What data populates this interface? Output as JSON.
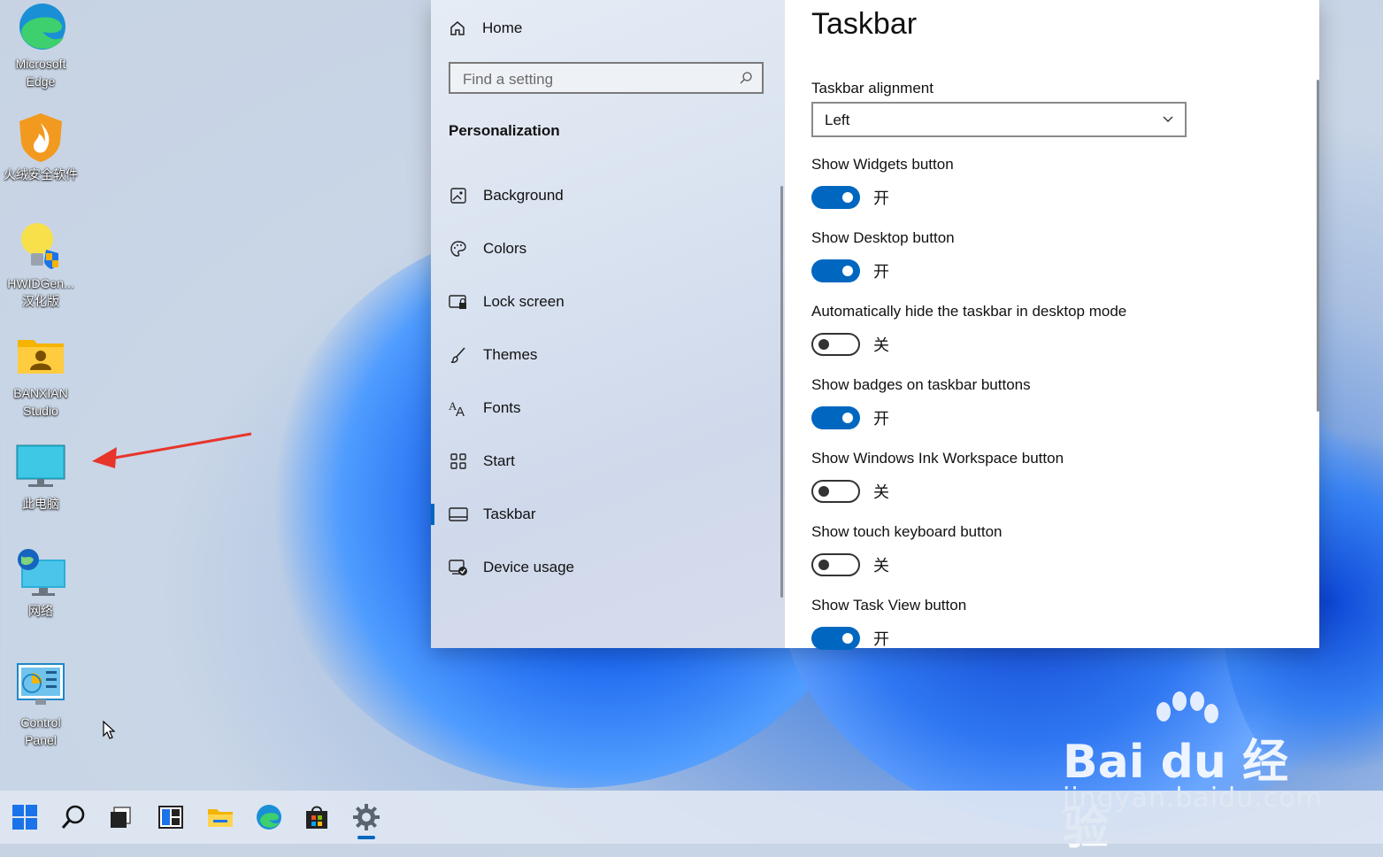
{
  "desktop": {
    "icons": [
      {
        "label": "Microsoft\nEdge",
        "icon": "edge-icon"
      },
      {
        "label": "火绒安全软件",
        "icon": "huorong-security-icon"
      },
      {
        "label": "HWIDGen...\n汉化版",
        "icon": "lightbulb-app-icon"
      },
      {
        "label": "BANXIAN\nStudio",
        "icon": "user-folder-icon"
      },
      {
        "label": "此电脑",
        "icon": "this-pc-icon"
      },
      {
        "label": "网络",
        "icon": "network-icon"
      },
      {
        "label": "Control\nPanel",
        "icon": "control-panel-icon"
      }
    ]
  },
  "settings": {
    "home_label": "Home",
    "search_placeholder": "Find a setting",
    "section_title": "Personalization",
    "nav_items": [
      {
        "label": "Background",
        "icon": "picture-icon"
      },
      {
        "label": "Colors",
        "icon": "palette-icon"
      },
      {
        "label": "Lock screen",
        "icon": "lock-screen-icon"
      },
      {
        "label": "Themes",
        "icon": "brush-icon"
      },
      {
        "label": "Fonts",
        "icon": "fonts-icon"
      },
      {
        "label": "Start",
        "icon": "start-grid-icon"
      },
      {
        "label": "Taskbar",
        "icon": "taskbar-icon",
        "active": true
      },
      {
        "label": "Device usage",
        "icon": "device-usage-icon"
      }
    ],
    "page_title": "Taskbar",
    "alignment_label": "Taskbar alignment",
    "alignment_value": "Left",
    "toggles": [
      {
        "label": "Show Widgets button",
        "on": true,
        "state": "开"
      },
      {
        "label": "Show Desktop button",
        "on": true,
        "state": "开"
      },
      {
        "label": "Automatically hide the taskbar in desktop mode",
        "on": false,
        "state": "关"
      },
      {
        "label": "Show badges on taskbar buttons",
        "on": true,
        "state": "开"
      },
      {
        "label": "Show Windows Ink Workspace button",
        "on": false,
        "state": "关"
      },
      {
        "label": "Show touch keyboard button",
        "on": false,
        "state": "关"
      },
      {
        "label": "Show Task View button",
        "on": true,
        "state": "开"
      }
    ]
  },
  "taskbar": {
    "buttons": [
      "start-icon",
      "search-icon",
      "task-view-icon",
      "widgets-icon",
      "file-explorer-icon",
      "edge-icon",
      "store-icon",
      "settings-gear-icon"
    ],
    "active": "settings-gear-icon"
  },
  "watermark": {
    "main": "Bai du 经验",
    "sub": "jingyan.baidu.com"
  },
  "colors": {
    "accent": "#0067c0",
    "arrow": "#e8352b"
  }
}
